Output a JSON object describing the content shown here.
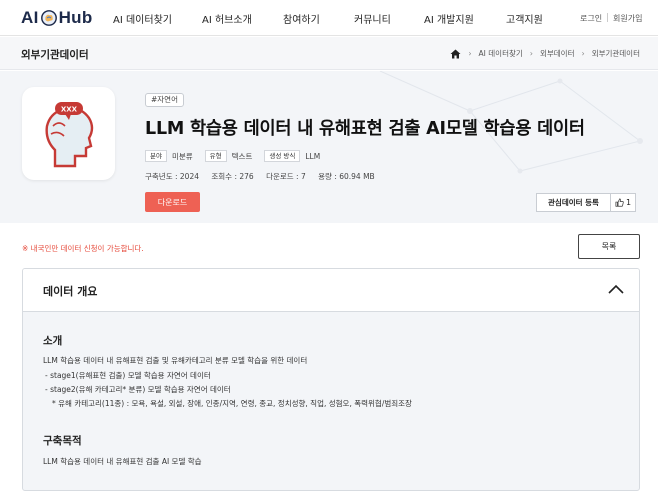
{
  "logo": {
    "text_left": "AI",
    "text_right": "Hub"
  },
  "nav": {
    "items": [
      "AI 데이터찾기",
      "AI 허브소개",
      "참여하기",
      "커뮤니티",
      "AI 개발지원",
      "고객지원"
    ],
    "login": "로그인",
    "signup": "회원가입"
  },
  "subheader": {
    "title": "외부기관데이터",
    "breadcrumb": [
      "AI 데이터찾기",
      "외부데이터",
      "외부기관데이터"
    ]
  },
  "dataset": {
    "tag": "#자연어",
    "title": "LLM 학습용 데이터 내 유해표현 검출 AI모델 학습용 데이터",
    "meta": [
      {
        "label": "분야",
        "value": "미분류"
      },
      {
        "label": "유형",
        "value": "텍스트"
      },
      {
        "label": "생성 방식",
        "value": "LLM"
      }
    ],
    "stats": {
      "year": "구축년도 : 2024",
      "views": "조회수 : 276",
      "downloads": "다운로드 : 7",
      "size": "용량 : 60.94 MB"
    },
    "thumbnail_badge": "XXX",
    "download_label": "다운로드",
    "favorite_label": "관심데이터 등록",
    "like_count": "1"
  },
  "notice": "※ 내국인만 데이터 신청이 가능합니다.",
  "list_button": "목록",
  "overview": {
    "title": "데이터 개요",
    "intro_title": "소개",
    "intro_lines": [
      "LLM 학습용 데이터 내 유해표현 검출 및 유해카테고리 분류 모델 학습을 위한 데이터",
      "- stage1(유해표현 검출) 모델 학습용 자연어 데이터",
      "- stage2(유해 카테고리* 분류) 모델 학습용 자연어 데이터",
      "* 유해 카테고리(11종) : 모욕, 욕설, 외설, 장애, 인종/지역, 연령, 종교, 정치성향, 직업, 성혐오, 폭력위협/범죄조장"
    ],
    "purpose_title": "구축목적",
    "purpose_lines": [
      "LLM 학습용 데이터 내 유해표현 검출 AI 모델 학습"
    ]
  },
  "colors": {
    "accent_red": "#ee6154",
    "notice_red": "#e64a3b",
    "logo_navy": "#1d2a4a",
    "panel_bg": "#f3f5f8"
  },
  "icons": {
    "home": "home-icon",
    "breadcrumb_sep": "chevron-right-icon",
    "like": "thumbs-up-icon",
    "collapse": "chevron-up-icon",
    "thumbnail": "head-profile-icon",
    "logo_mark": "brain-icon"
  }
}
